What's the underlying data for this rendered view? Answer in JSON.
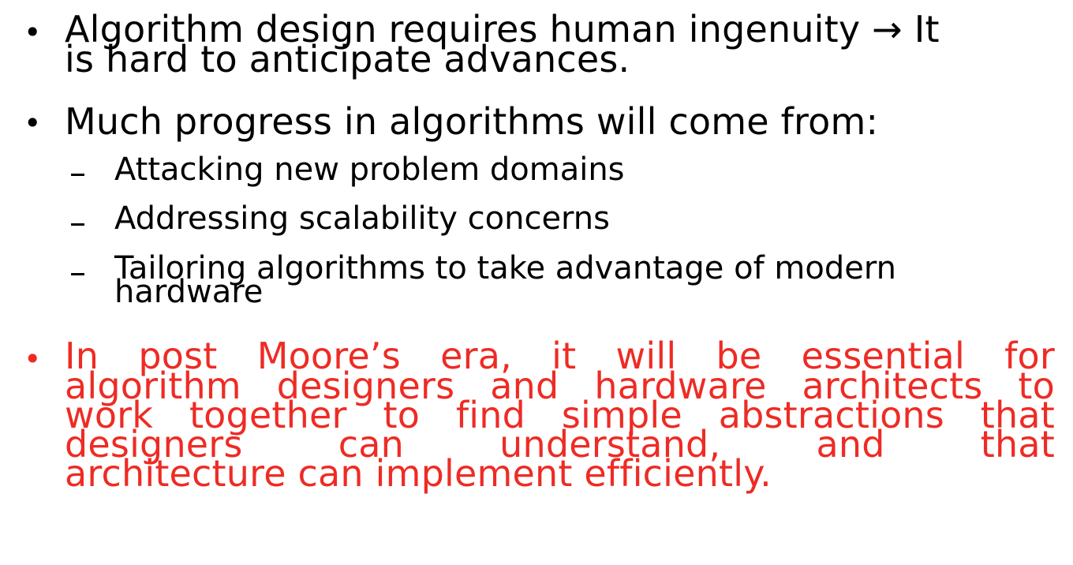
{
  "bullets": [
    {
      "lines": [
        "Algorithm design requires human ingenuity → It",
        "is hard to anticipate advances."
      ]
    },
    {
      "lines": [
        "Much progress in algorithms will come from:"
      ],
      "sub_items": [
        {
          "lines": [
            "Attacking new problem domains"
          ]
        },
        {
          "lines": [
            "Addressing scalability concerns"
          ]
        },
        {
          "lines": [
            "Tailoring algorithms to take advantage of modern",
            "hardware"
          ]
        }
      ]
    },
    {
      "lines": [
        "In post Moore’s era, it will be essential for",
        "algorithm designers and hardware architects to",
        "work together to find simple abstractions that",
        "designers can understand, and that",
        "architecture can implement efficiently."
      ],
      "color": "#ee2b24"
    }
  ],
  "bullet_symbol": "•",
  "dash_symbol": "–"
}
